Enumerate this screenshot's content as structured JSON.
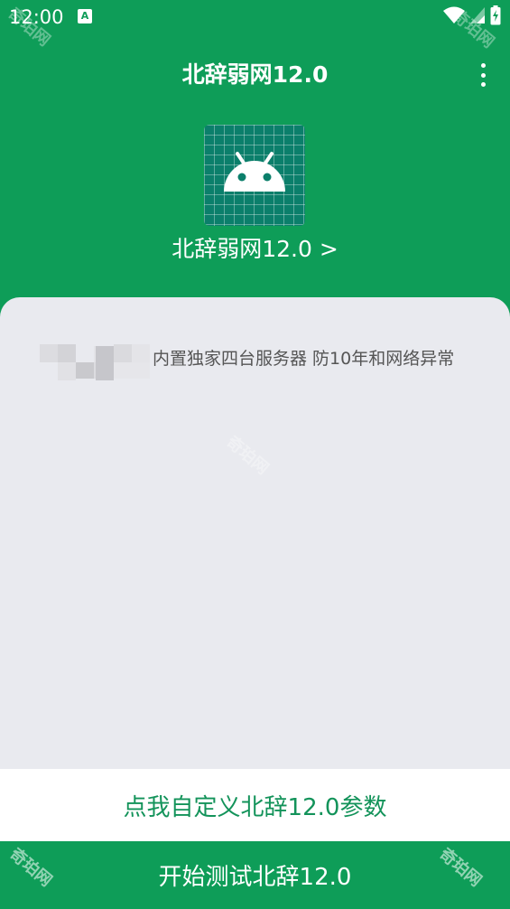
{
  "status_bar": {
    "time": "12:00",
    "notification_icon": "A"
  },
  "app_bar": {
    "title": "北辞弱网12.0",
    "overflow_icon": "more-vert-icon"
  },
  "header": {
    "app_icon": "android-icon",
    "app_name_link": "北辞弱网12.0 >"
  },
  "content": {
    "notice_text": "内置独家四台服务器 防10年和网络异常"
  },
  "buttons": {
    "custom_params": "点我自定义北辞12.0参数",
    "start_test": "开始测试北辞12.0"
  },
  "watermark": {
    "text": "奇珀网"
  },
  "colors": {
    "primary": "#0e9d58",
    "card_background": "#e9eaef",
    "accent_text": "#13935a"
  }
}
